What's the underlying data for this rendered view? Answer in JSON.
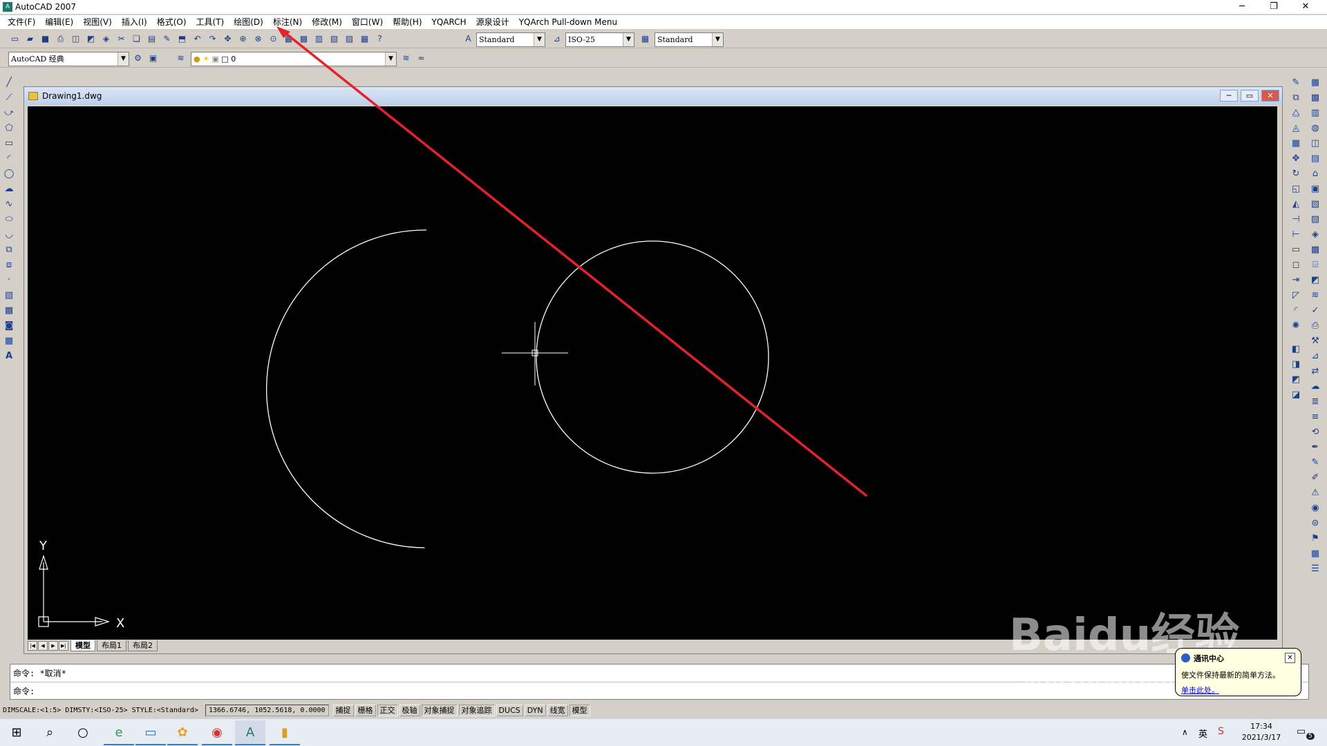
{
  "window": {
    "title": "AutoCAD 2007",
    "minimize": "─",
    "restore": "❐",
    "close": "✕"
  },
  "menu": [
    "文件(F)",
    "编辑(E)",
    "视图(V)",
    "插入(I)",
    "格式(O)",
    "工具(T)",
    "绘图(D)",
    "标注(N)",
    "修改(M)",
    "窗口(W)",
    "帮助(H)",
    "YQARCH",
    "源泉设计",
    "YQArch Pull-down Menu"
  ],
  "toolbar": {
    "text_style": "Standard",
    "dim_style": "ISO-25",
    "table_style": "Standard",
    "workspace": "AutoCAD 经典",
    "layer": "0"
  },
  "drawing": {
    "title": "Drawing1.dwg"
  },
  "ucs": {
    "x_label": "X",
    "y_label": "Y"
  },
  "layout_tabs": [
    "模型",
    "布局1",
    "布局2"
  ],
  "command": {
    "history": "命令: *取消*",
    "prompt": "命令:"
  },
  "status": {
    "dimscale": "DIMSCALE:<1:5> DIMSTY:<ISO-25> STYLE:<Standard>",
    "coords": "1366.6746, 1052.5618, 0.0000",
    "buttons": [
      "捕捉",
      "栅格",
      "正交",
      "极轴",
      "对象捕捉",
      "对象追踪",
      "DUCS",
      "DYN",
      "线宽",
      "模型"
    ]
  },
  "notification": {
    "title": "通讯中心",
    "text": "使文件保持最新的简单方法。",
    "link": "单击此处。"
  },
  "tray": {
    "ime": "英",
    "time": "17:34",
    "date": "2021/3/17",
    "notif_count": "5"
  },
  "watermark": {
    "brand": "Baidu经验",
    "url": "jingyan.baidu.com"
  },
  "colors": {
    "canvas": "#000000",
    "annotation": "#e8202a",
    "entities": "#ffffff"
  }
}
